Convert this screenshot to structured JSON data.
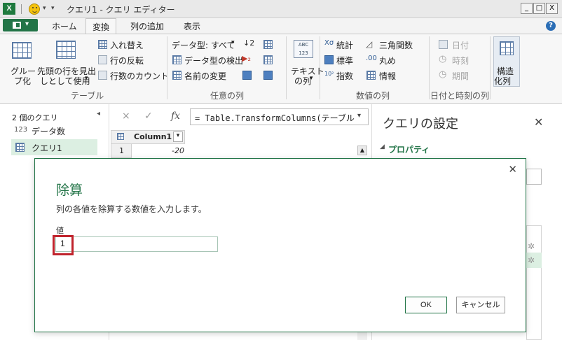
{
  "window": {
    "title": "クエリ1 - クエリ エディター",
    "app_icon": "X",
    "controls": {
      "minimize": "_",
      "maximize": "□",
      "close": "X"
    }
  },
  "ribbon_tabs": {
    "file_icon": "file-menu-icon",
    "tabs": [
      "ホーム",
      "変換",
      "列の追加",
      "表示"
    ],
    "active": "変換",
    "help": "?"
  },
  "ribbon": {
    "table_group": {
      "label": "テーブル",
      "group_by": [
        "グルー",
        "プ化"
      ],
      "use_first_row": [
        "先頭の行を見出",
        "しとして使用"
      ],
      "transpose": "入れ替え",
      "reverse_rows": "行の反転",
      "count_rows": "行数のカウント"
    },
    "any_column_group": {
      "label": "任意の列",
      "data_type": "データ型: すべて",
      "detect_type": "データ型の検出",
      "rename": "名前の変更"
    },
    "text_group": {
      "text_column": [
        "テキスト",
        "の列"
      ]
    },
    "number_group": {
      "label": "数値の列",
      "statistics": "統計",
      "standard": "標準",
      "scientific": "指数",
      "trigonometry": "三角関数",
      "rounding": "丸め",
      "information": "情報"
    },
    "datetime_group": {
      "label": "日付と時刻の列",
      "date": "日付",
      "time": "時刻",
      "duration": "期間"
    },
    "structured_group": {
      "structured_column": [
        "構造",
        "化列"
      ]
    }
  },
  "navigator": {
    "title": "2 個のクエリ",
    "items": [
      {
        "label": "データ数",
        "prefix": "123"
      },
      {
        "label": "クエリ1",
        "selected": true
      }
    ]
  },
  "formula_bar": {
    "cancel": "×",
    "accept": "✓",
    "fx": "fx",
    "formula": "= Table.TransformColumns(テーブル"
  },
  "grid": {
    "column_header": "Column1",
    "rows": [
      {
        "index": "1",
        "value": "-20"
      }
    ]
  },
  "settings": {
    "title": "クエリの設定",
    "properties": "プロパティ"
  },
  "dialog": {
    "title": "除算",
    "description": "列の各値を除算する数値を入力します。",
    "field_label": "値",
    "field_value": "1",
    "ok": "OK",
    "cancel": "キャンセル"
  }
}
